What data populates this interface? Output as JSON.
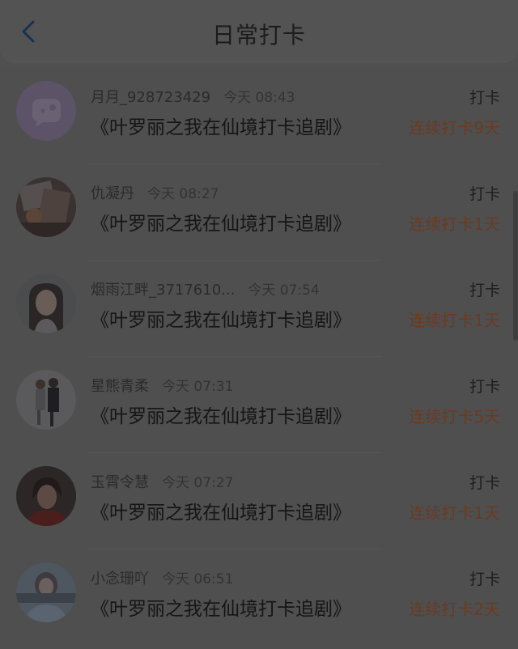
{
  "header": {
    "title": "日常打卡",
    "back_icon": "chevron-left-icon"
  },
  "checkins": [
    {
      "user": "月月_928723429",
      "time": "今天 08:43",
      "drama": "《叶罗丽之我在仙境打卡追剧》",
      "action": "打卡",
      "streak": "连续打卡9天"
    },
    {
      "user": "仇凝丹",
      "time": "今天 08:27",
      "drama": "《叶罗丽之我在仙境打卡追剧》",
      "action": "打卡",
      "streak": "连续打卡1天"
    },
    {
      "user": "烟雨江畔_3717610...",
      "time": "今天 07:54",
      "drama": "《叶罗丽之我在仙境打卡追剧》",
      "action": "打卡",
      "streak": "连续打卡1天"
    },
    {
      "user": "星熊青柔",
      "time": "今天 07:31",
      "drama": "《叶罗丽之我在仙境打卡追剧》",
      "action": "打卡",
      "streak": "连续打卡5天"
    },
    {
      "user": "玉霄令慧",
      "time": "今天 07:27",
      "drama": "《叶罗丽之我在仙境打卡追剧》",
      "action": "打卡",
      "streak": "连续打卡1天"
    },
    {
      "user": "小念珊吖",
      "time": "今天 06:51",
      "drama": "《叶罗丽之我在仙境打卡追剧》",
      "action": "打卡",
      "streak": "连续打卡2天"
    }
  ]
}
